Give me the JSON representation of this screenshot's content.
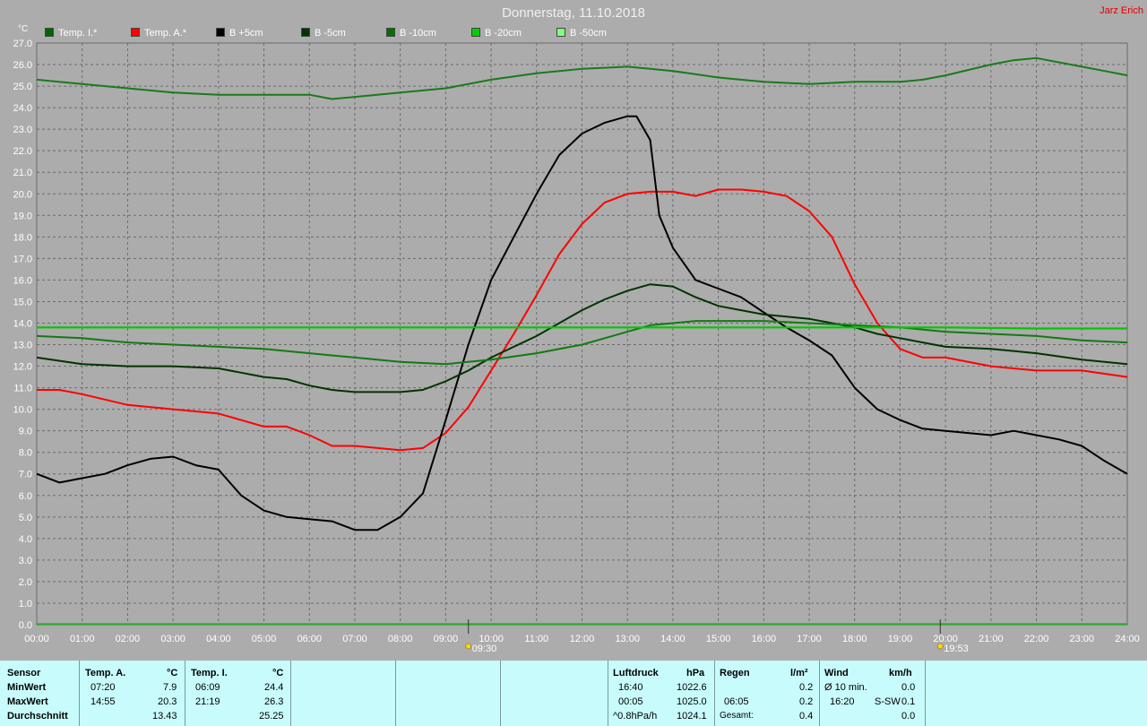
{
  "title": "Donnerstag, 11.10.2018",
  "author": "Jarz Erich",
  "y_unit": "°C",
  "legend": [
    {
      "label": "Temp. I.*",
      "color": "#006600"
    },
    {
      "label": "Temp. A.*",
      "color": "#ff0000"
    },
    {
      "label": "B +5cm",
      "color": "#000000"
    },
    {
      "label": "B -5cm",
      "color": "#003300"
    },
    {
      "label": "B -10cm",
      "color": "#007000"
    },
    {
      "label": "B -20cm",
      "color": "#00d000"
    },
    {
      "label": "B -50cm",
      "color": "#80ff80"
    }
  ],
  "markers": {
    "sunrise": "09:30",
    "sunset": "19:53"
  },
  "chart_data": {
    "type": "line",
    "title": "Donnerstag, 11.10.2018",
    "ylabel": "°C",
    "ylim": [
      0,
      27
    ],
    "yticks": [
      "0.0",
      "1.0",
      "2.0",
      "3.0",
      "4.0",
      "5.0",
      "6.0",
      "7.0",
      "8.0",
      "9.0",
      "10.0",
      "11.0",
      "12.0",
      "13.0",
      "14.0",
      "15.0",
      "16.0",
      "17.0",
      "18.0",
      "19.0",
      "20.0",
      "21.0",
      "22.0",
      "23.0",
      "24.0",
      "25.0",
      "26.0",
      "27.0"
    ],
    "xlim": [
      0,
      24
    ],
    "xticks": [
      "00:00",
      "01:00",
      "02:00",
      "03:00",
      "04:00",
      "05:00",
      "06:00",
      "07:00",
      "08:00",
      "09:00",
      "10:00",
      "11:00",
      "12:00",
      "13:00",
      "14:00",
      "15:00",
      "16:00",
      "17:00",
      "18:00",
      "19:00",
      "20:00",
      "21:00",
      "22:00",
      "23:00",
      "24:00"
    ],
    "grid": true,
    "series": [
      {
        "name": "Temp. I.*",
        "color": "#1a7a1a",
        "x": [
          0,
          1,
          2,
          3,
          4,
          5,
          6,
          6.5,
          7,
          8,
          9,
          10,
          11,
          12,
          12.5,
          13,
          13.5,
          14,
          15,
          16,
          17,
          18,
          19,
          19.5,
          20,
          21,
          21.5,
          22,
          23,
          23.5,
          24
        ],
        "y": [
          25.3,
          25.1,
          24.9,
          24.7,
          24.6,
          24.6,
          24.6,
          24.4,
          24.5,
          24.7,
          24.9,
          25.3,
          25.6,
          25.8,
          25.85,
          25.9,
          25.8,
          25.7,
          25.4,
          25.2,
          25.1,
          25.2,
          25.2,
          25.3,
          25.5,
          26.0,
          26.2,
          26.3,
          25.9,
          25.7,
          25.5
        ]
      },
      {
        "name": "Temp. A.*",
        "color": "#ff0000",
        "x": [
          0,
          0.5,
          1,
          2,
          3,
          4,
          5,
          5.5,
          6,
          6.5,
          7,
          8,
          8.5,
          9,
          9.5,
          10,
          10.5,
          11,
          11.5,
          12,
          12.5,
          13,
          13.5,
          14,
          14.5,
          15,
          15.5,
          16,
          16.5,
          17,
          17.5,
          18,
          18.5,
          19,
          19.5,
          20,
          21,
          22,
          23,
          24
        ],
        "y": [
          10.9,
          10.9,
          10.7,
          10.2,
          10.0,
          9.8,
          9.2,
          9.2,
          8.8,
          8.3,
          8.3,
          8.1,
          8.2,
          8.9,
          10.1,
          11.8,
          13.5,
          15.3,
          17.2,
          18.6,
          19.6,
          20.0,
          20.1,
          20.1,
          19.9,
          20.2,
          20.2,
          20.1,
          19.9,
          19.2,
          18.0,
          15.8,
          14.0,
          12.8,
          12.4,
          12.4,
          12.0,
          11.8,
          11.8,
          11.5
        ]
      },
      {
        "name": "B +5cm",
        "color": "#000000",
        "x": [
          0,
          0.5,
          1,
          1.5,
          2,
          2.5,
          3,
          3.5,
          4,
          4.5,
          5,
          5.5,
          6,
          6.5,
          7,
          7.5,
          8,
          8.5,
          9,
          9.5,
          10,
          10.5,
          11,
          11.5,
          12,
          12.5,
          13,
          13.2,
          13.5,
          13.7,
          14,
          14.5,
          15,
          15.5,
          16,
          16.5,
          17,
          17.5,
          18,
          18.5,
          19,
          19.5,
          20,
          21,
          21.5,
          22,
          22.5,
          23,
          23.5,
          24
        ],
        "y": [
          7.0,
          6.6,
          6.8,
          7.0,
          7.4,
          7.7,
          7.8,
          7.4,
          7.2,
          6.0,
          5.3,
          5.0,
          4.9,
          4.8,
          4.4,
          4.4,
          5.0,
          6.1,
          9.5,
          13.0,
          16.0,
          18.0,
          20.0,
          21.8,
          22.8,
          23.3,
          23.6,
          23.6,
          22.5,
          19.0,
          17.5,
          16.0,
          15.6,
          15.2,
          14.5,
          13.8,
          13.2,
          12.5,
          11.0,
          10.0,
          9.5,
          9.1,
          9.0,
          8.8,
          9.0,
          8.8,
          8.6,
          8.3,
          7.6,
          7.0
        ]
      },
      {
        "name": "B -5cm",
        "color": "#003300",
        "x": [
          0,
          1,
          2,
          3,
          4,
          4.5,
          5,
          5.5,
          6,
          6.5,
          7,
          7.5,
          8,
          8.5,
          9,
          9.5,
          10,
          10.5,
          11,
          11.5,
          12,
          12.5,
          13,
          13.5,
          14,
          14.5,
          15,
          15.5,
          16,
          16.5,
          17,
          17.5,
          18,
          18.5,
          19,
          19.5,
          20,
          21,
          22,
          23,
          24
        ],
        "y": [
          12.4,
          12.1,
          12.0,
          12.0,
          11.9,
          11.7,
          11.5,
          11.4,
          11.1,
          10.9,
          10.8,
          10.8,
          10.8,
          10.9,
          11.3,
          11.8,
          12.4,
          12.9,
          13.4,
          14.0,
          14.6,
          15.1,
          15.5,
          15.8,
          15.7,
          15.2,
          14.8,
          14.6,
          14.4,
          14.3,
          14.2,
          14.0,
          13.8,
          13.5,
          13.3,
          13.1,
          12.9,
          12.8,
          12.6,
          12.3,
          12.1
        ]
      },
      {
        "name": "B -10cm",
        "color": "#127a12",
        "x": [
          0,
          1,
          2,
          3,
          4,
          5,
          6,
          7,
          8,
          9,
          10,
          11,
          12,
          12.5,
          13,
          13.5,
          14,
          14.5,
          15,
          16,
          17,
          18,
          19,
          20,
          21,
          22,
          23,
          24
        ],
        "y": [
          13.4,
          13.3,
          13.1,
          13.0,
          12.9,
          12.8,
          12.6,
          12.4,
          12.2,
          12.1,
          12.3,
          12.6,
          13.0,
          13.3,
          13.6,
          13.9,
          14.0,
          14.1,
          14.1,
          14.1,
          14.0,
          13.9,
          13.8,
          13.6,
          13.5,
          13.4,
          13.2,
          13.1
        ]
      },
      {
        "name": "B -20cm",
        "color": "#00c800",
        "x": [
          0,
          2,
          4,
          6,
          8,
          10,
          12,
          14,
          16,
          18,
          20,
          22,
          24
        ],
        "y": [
          13.8,
          13.8,
          13.8,
          13.8,
          13.8,
          13.8,
          13.8,
          13.8,
          13.8,
          13.8,
          13.8,
          13.75,
          13.75
        ]
      },
      {
        "name": "B -50cm",
        "color": "#80ff80",
        "x": [],
        "y": []
      }
    ]
  },
  "table": {
    "sensor_header": "Sensor",
    "row_labels": [
      "MinWert",
      "MaxWert",
      "Durchschnitt"
    ],
    "temp_a": {
      "header": "Temp. A.",
      "unit": "°C",
      "min_time": "07:20",
      "min_val": "7.9",
      "max_time": "14:55",
      "max_val": "20.3",
      "avg": "13.43"
    },
    "temp_i": {
      "header": "Temp. I.",
      "unit": "°C",
      "min_time": "06:09",
      "min_val": "24.4",
      "max_time": "21:19",
      "max_val": "26.3",
      "avg": "25.25"
    },
    "pressure": {
      "header": "Luftdruck",
      "unit": "hPa",
      "min_time": "16:40",
      "min_val": "1022.6",
      "max_time": "00:05",
      "max_val": "1025.0",
      "trend_label": "^0.8hPa/h",
      "current": "1024.1"
    },
    "rain": {
      "header": "Regen",
      "unit": "l/m²",
      "val1": "0.2",
      "time2": "06:05",
      "val2": "0.2",
      "total_label": "Gesamt:",
      "total": "0.4"
    },
    "wind": {
      "header": "Wind",
      "unit": "km/h",
      "avg_label": "Ø 10 min.",
      "avg_val": "0.0",
      "time2": "16:20",
      "dir": "S-SW",
      "val2": "0.1",
      "val3": "0.0"
    }
  }
}
